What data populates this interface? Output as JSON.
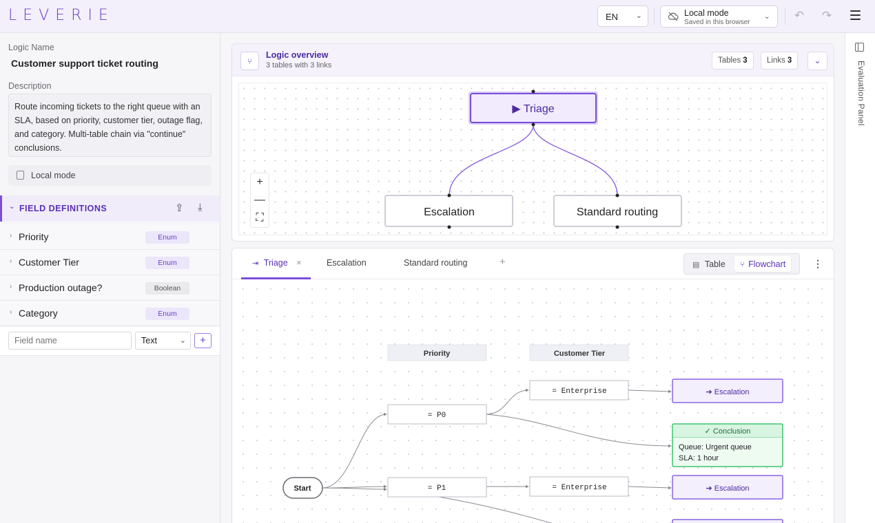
{
  "app": {
    "logo": "LEVERIE"
  },
  "topbar": {
    "language": "EN",
    "mode_title": "Local mode",
    "mode_subtitle": "Saved in this browser"
  },
  "sidebar": {
    "logic_name_label": "Logic Name",
    "logic_name": "Customer support ticket routing",
    "description_label": "Description",
    "description": "Route incoming tickets to the right queue with an SLA, based on priority, customer tier, outage flag, and category. Multi-table chain via \"continue\" conclusions.",
    "local_mode": "Local mode",
    "field_definitions_title": "FIELD DEFINITIONS",
    "fields": [
      {
        "name": "Priority",
        "type": "Enum"
      },
      {
        "name": "Customer Tier",
        "type": "Enum"
      },
      {
        "name": "Production outage?",
        "type": "Boolean"
      },
      {
        "name": "Category",
        "type": "Enum"
      }
    ],
    "new_field_placeholder": "Field name",
    "new_field_type": "Text",
    "add_label": "+"
  },
  "overview": {
    "title": "Logic overview",
    "subtitle": "3 tables with 3 links",
    "tables_label": "Tables",
    "tables_count": "3",
    "links_label": "Links",
    "links_count": "3",
    "nodes": {
      "root": "▶ Triage",
      "left": "Escalation",
      "right": "Standard routing"
    },
    "zoom_in": "+",
    "zoom_out": "—",
    "fit": "⛶"
  },
  "editor": {
    "tabs": [
      {
        "label": "Triage"
      },
      {
        "label": "Escalation"
      },
      {
        "label": "Standard routing"
      }
    ],
    "add_tab": "+",
    "close_tab": "×",
    "view_table": "Table",
    "view_flowchart": "Flowchart",
    "flow": {
      "col_headers": [
        "Priority",
        "Customer Tier"
      ],
      "start": "Start",
      "cond_p0": "= P0",
      "cond_p1": "= P1",
      "cond_ent1": "= Enterprise",
      "cond_ent2": "= Enterprise",
      "goto1": "➔ Escalation",
      "goto2": "➔ Escalation",
      "conclusion_title": "✓ Conclusion",
      "conclusion_queue": "Queue: Urgent queue",
      "conclusion_sla": "SLA: 1 hour"
    }
  },
  "right_panel": {
    "title": "Evaluation Panel"
  },
  "colors": {
    "accent": "#7c4ddb",
    "success": "#22b55a",
    "brand": "#6b3fc2"
  }
}
